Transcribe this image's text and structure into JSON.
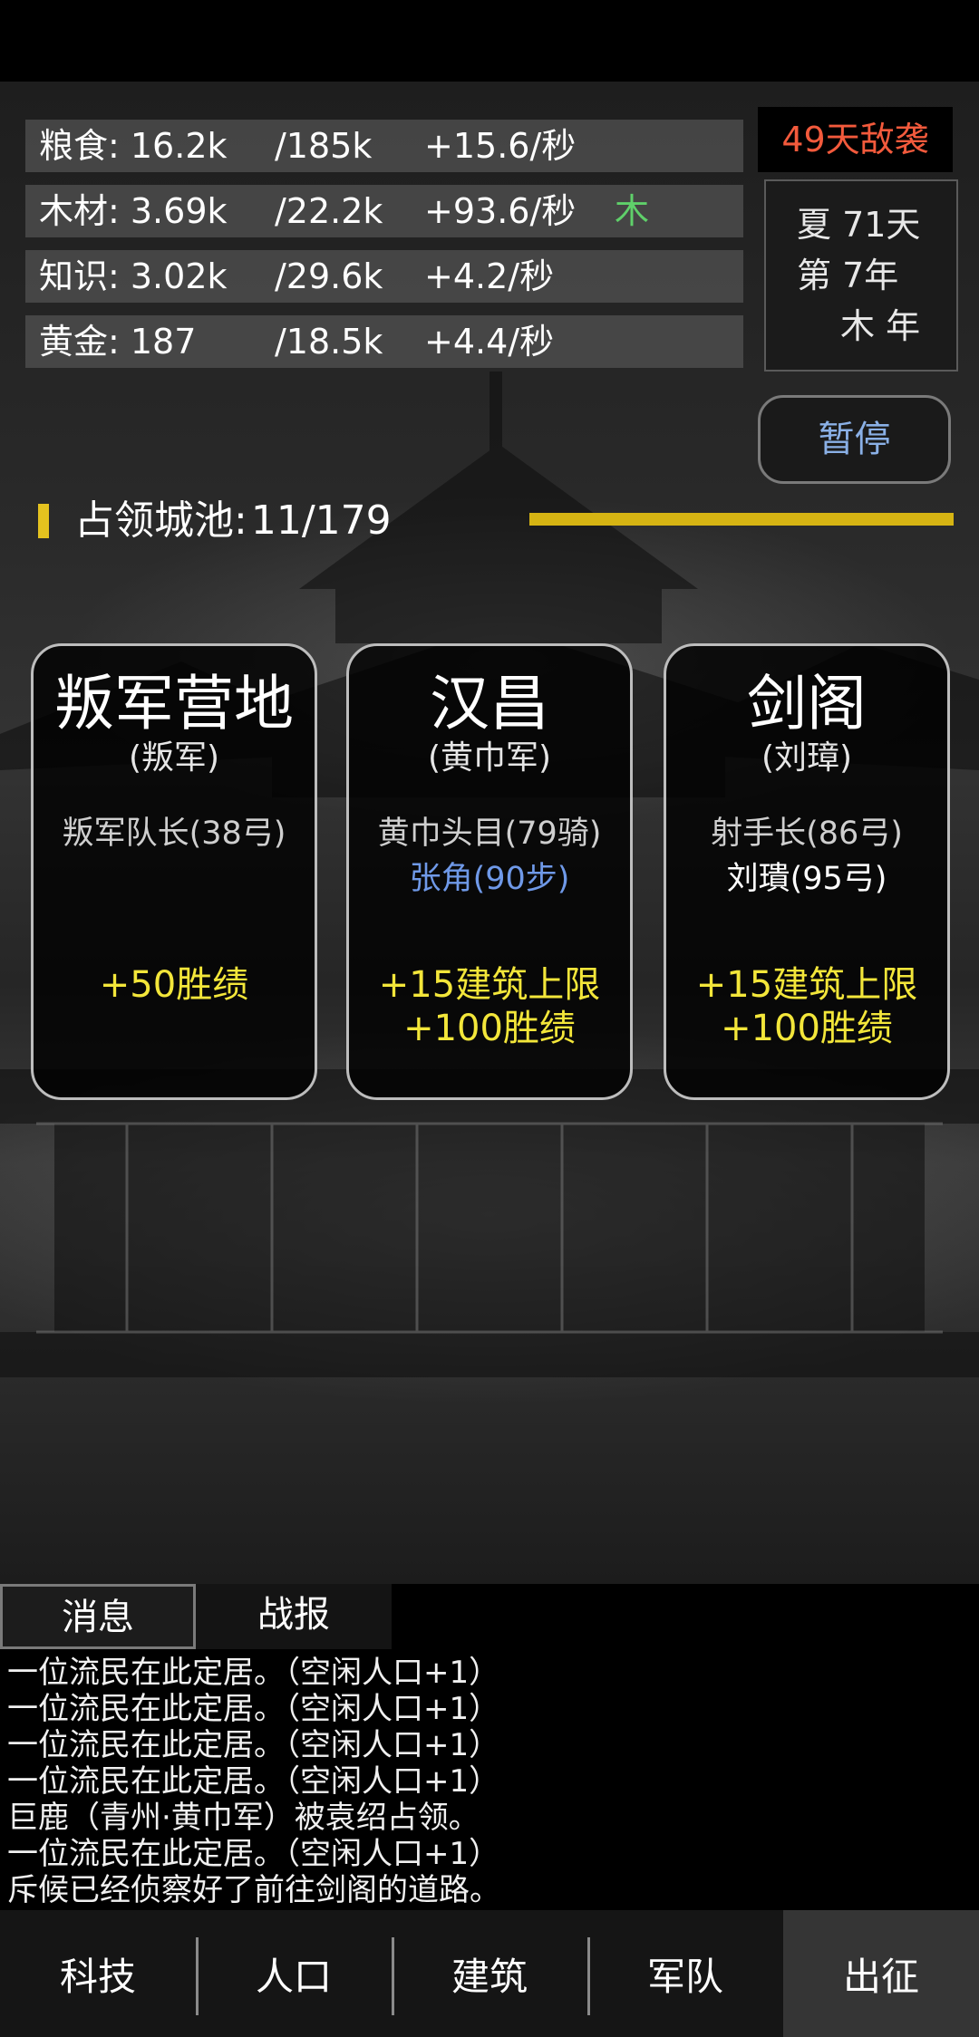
{
  "resources": [
    {
      "name": "粮食: 16.2k",
      "cap": "/185k",
      "rate": "+15.6/秒",
      "tag": ""
    },
    {
      "name": "木材: 3.69k",
      "cap": "/22.2k",
      "rate": "+93.6/秒",
      "tag": "木"
    },
    {
      "name": "知识: 3.02k",
      "cap": "/29.6k",
      "rate": "+4.2/秒",
      "tag": ""
    },
    {
      "name": "黄金: 187",
      "cap": "/18.5k",
      "rate": "+4.4/秒",
      "tag": ""
    }
  ],
  "enemy_warning": "49天敌袭",
  "date": {
    "line1": "夏 71天",
    "line2": "第 7年",
    "line3": "木 年"
  },
  "pause_label": "暂停",
  "cities": {
    "label": "占领城池:",
    "value": "11/179",
    "progress": 0.0615
  },
  "cards": [
    {
      "title": "叛军营地",
      "faction": "(叛军)",
      "general1": "叛军队长(38弓)",
      "general2": "",
      "reward1": "+50胜绩",
      "reward2": ""
    },
    {
      "title": "汉昌",
      "faction": "(黄巾军)",
      "general1": "黄巾头目(79骑)",
      "general2": "张角(90步)",
      "reward1": "+15建筑上限",
      "reward2": "+100胜绩"
    },
    {
      "title": "剑阁",
      "faction": "(刘璋)",
      "general1": "射手长(86弓)",
      "general2": "刘璝(95弓)",
      "reward1": "+15建筑上限",
      "reward2": "+100胜绩"
    }
  ],
  "tabs": {
    "messages": "消息",
    "battle": "战报"
  },
  "log": [
    "一位流民在此定居。（空闲人口+1）",
    "一位流民在此定居。（空闲人口+1）",
    "一位流民在此定居。（空闲人口+1）",
    "一位流民在此定居。（空闲人口+1）",
    "巨鹿（青州·黄巾军）被袁绍占领。",
    "一位流民在此定居。（空闲人口+1）",
    "斥候已经侦察好了前往剑阁的道路。"
  ],
  "nav": [
    "科技",
    "人口",
    "建筑",
    "军队",
    "出征"
  ],
  "colors": {
    "accent_yellow": "#d6b413",
    "reward_yellow": "#f3e63a",
    "enemy_red": "#f35a3c",
    "ally_blue": "#6f99e8",
    "wood_green": "#5fd06a"
  }
}
